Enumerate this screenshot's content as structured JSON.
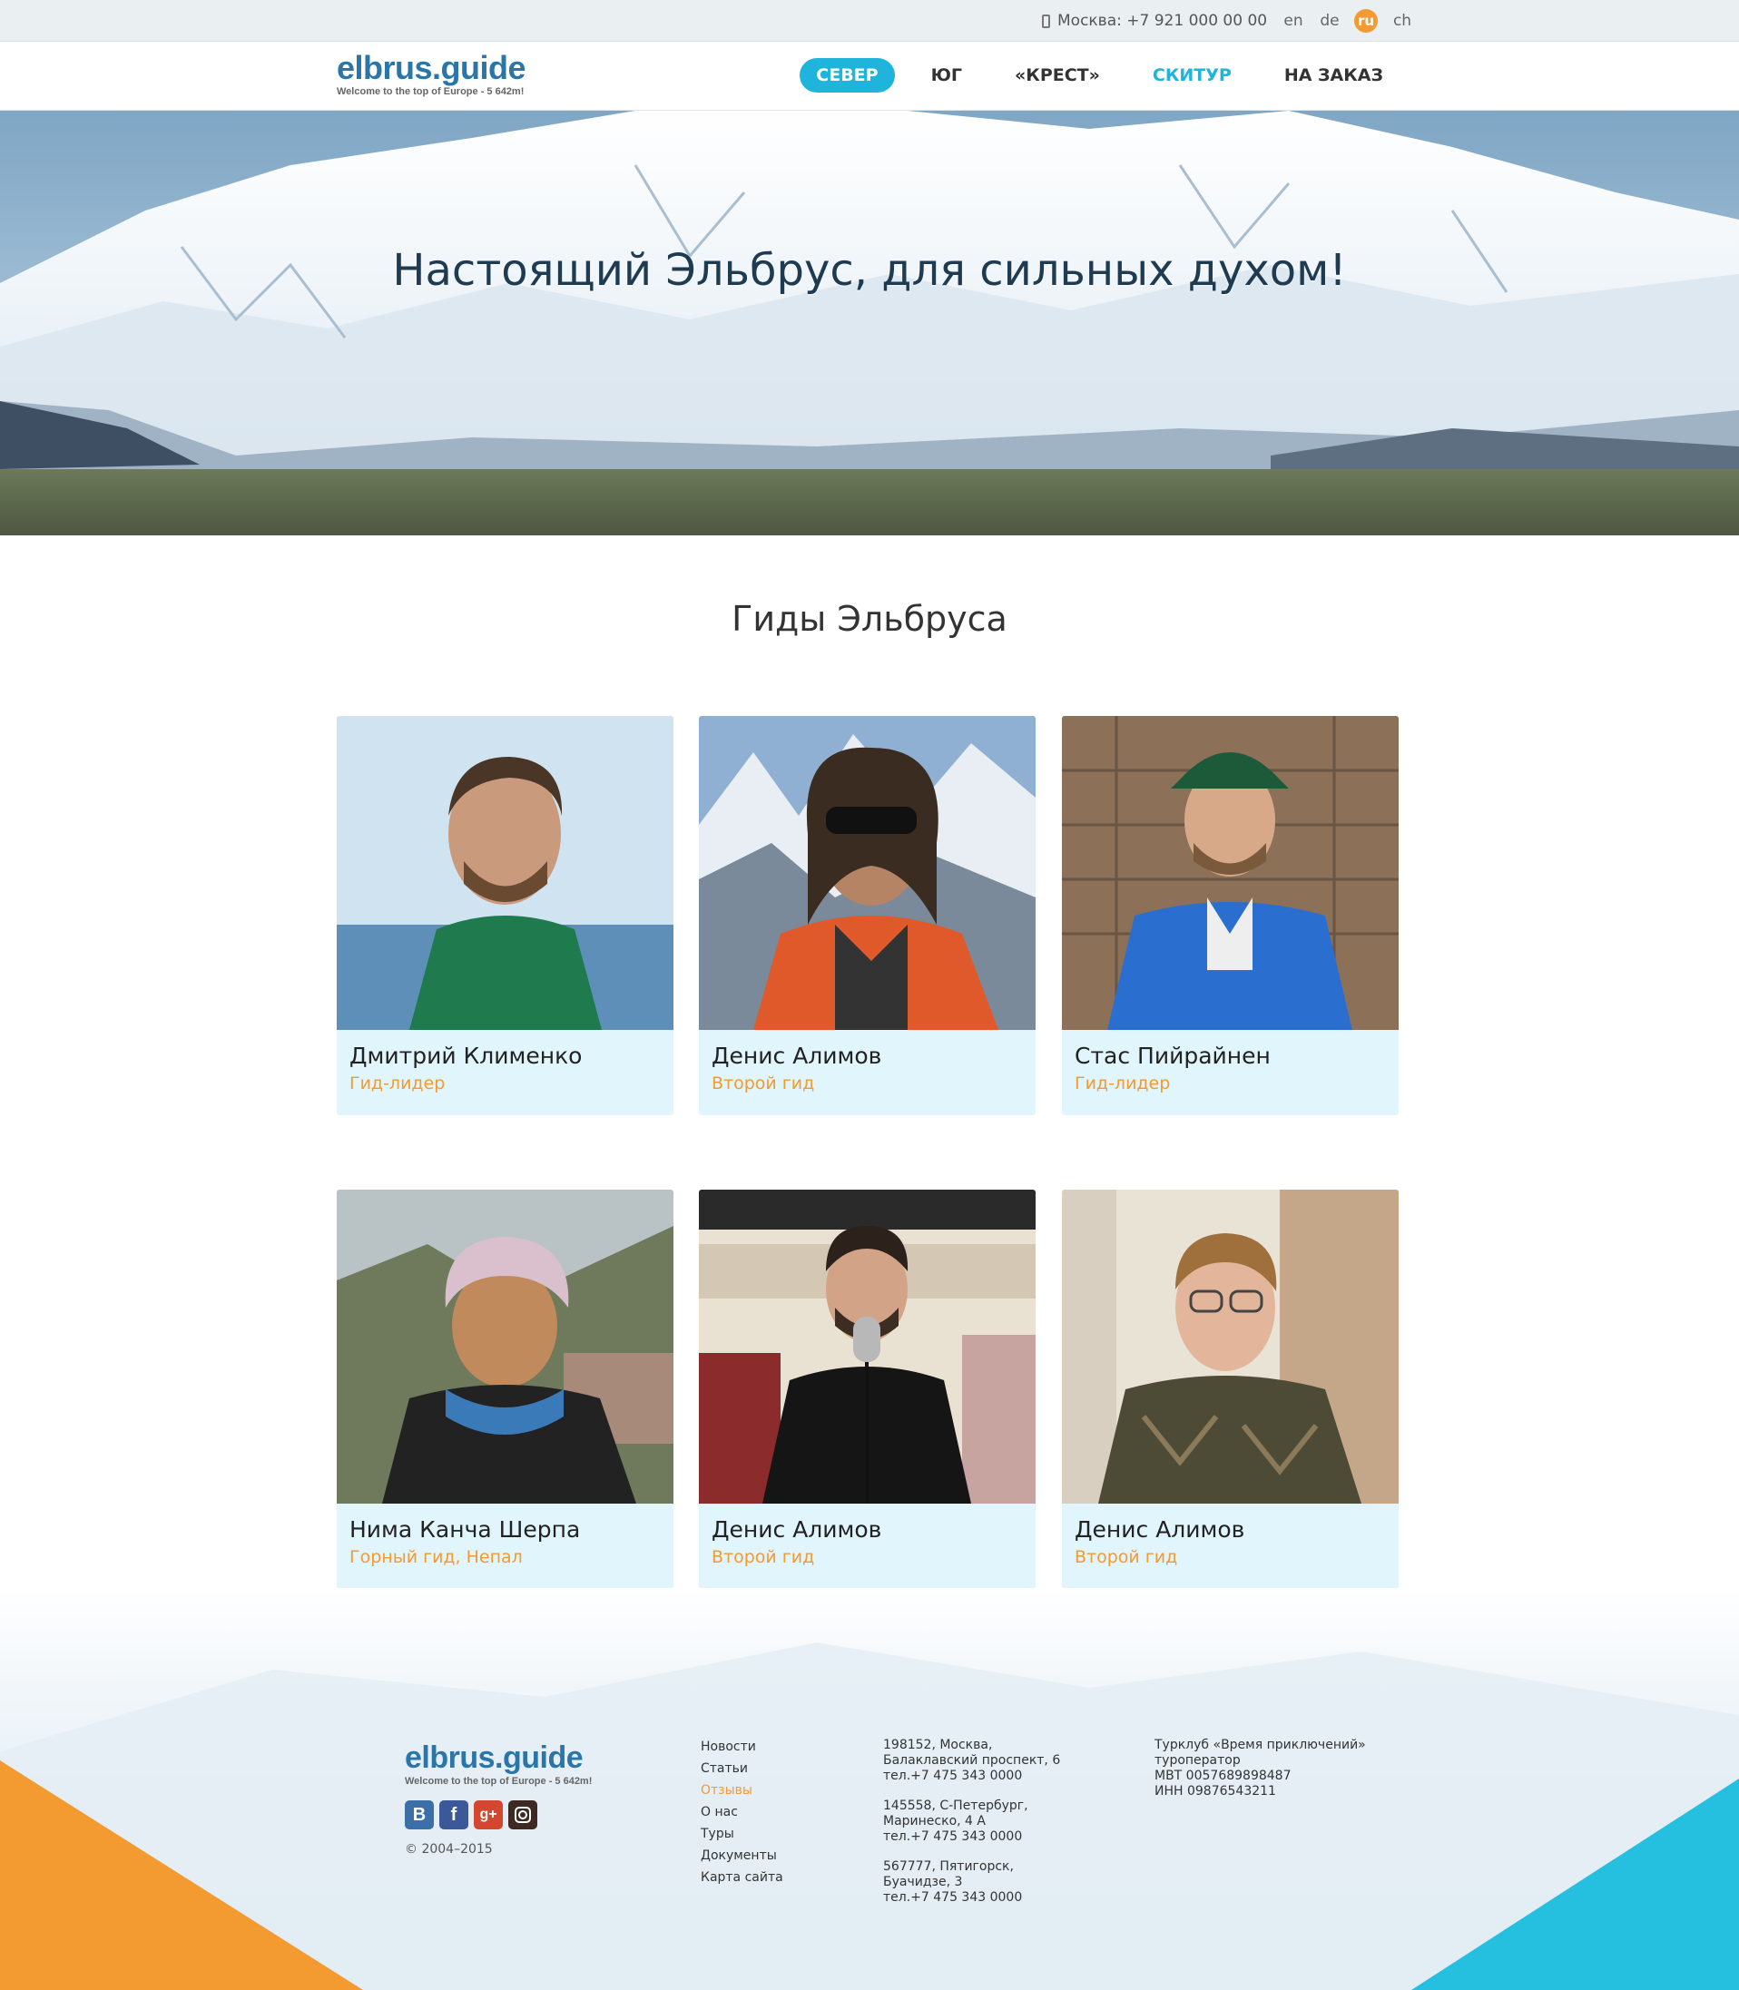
{
  "topbar": {
    "phone": "Москва: +7 921 000 00 00",
    "languages": [
      "en",
      "de",
      "ru",
      "ch"
    ],
    "active_language": "ru"
  },
  "header": {
    "logo_title": "elbrus.guide",
    "logo_subtitle": "Welcome to the top of Europe - 5 642m!",
    "nav": [
      "СЕВЕР",
      "ЮГ",
      "«КРЕСТ»",
      "СКИТУР",
      "НА ЗАКАЗ"
    ]
  },
  "hero": {
    "title": "Настоящий Эльбрус, для сильных духом!"
  },
  "guides": {
    "title": "Гиды Эльбруса",
    "items": [
      {
        "name": "Дмитрий Клименко",
        "role": "Гид-лидер"
      },
      {
        "name": "Денис Алимов",
        "role": "Второй гид"
      },
      {
        "name": "Стас Пийрайнен",
        "role": "Гид-лидер"
      },
      {
        "name": "Нима Канча Шерпа",
        "role": "Горный гид, Непал"
      },
      {
        "name": "Денис Алимов",
        "role": "Второй гид"
      },
      {
        "name": "Денис Алимов",
        "role": "Второй гид"
      }
    ]
  },
  "footer": {
    "logo_title": "elbrus.guide",
    "logo_subtitle": "Welcome to the top of Europe - 5 642m!",
    "socials": [
      "B",
      "f",
      "g+",
      "instagram-icon"
    ],
    "copyright": "© 2004–2015",
    "menu": [
      "Новости",
      "Статьи",
      "Отзывы",
      "О нас",
      "Туры",
      "Документы",
      "Карта сайта"
    ],
    "active_menu": "Отзывы",
    "addresses": [
      [
        "198152, Москва,",
        "Балаклавский проспект, 6",
        "тел.+7 475 343 0000"
      ],
      [
        "145558, С-Петербург,",
        "Маринеско, 4 А",
        "тел.+7 475 343 0000"
      ],
      [
        "567777, Пятигорск,",
        "Буачидзе, 3",
        "тел.+7 475 343 0000"
      ]
    ],
    "company": [
      "Турклуб «Время приключений»",
      "туроператор",
      "МВТ 0057689898487",
      "ИНН 09876543211"
    ]
  },
  "colors": {
    "accent_blue": "#1fb4dc",
    "accent_orange": "#f39a30",
    "logo_blue": "#2a76a8",
    "card_bg": "#e1f5fc"
  }
}
